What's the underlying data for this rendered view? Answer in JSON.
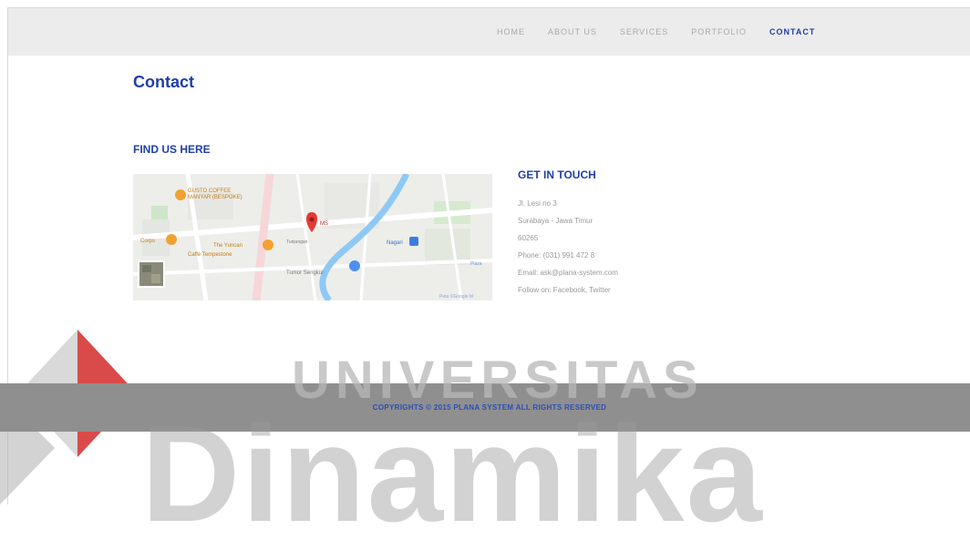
{
  "nav": {
    "items": [
      "HOME",
      "ABOUT US",
      "SERVICES",
      "PORTFOLIO",
      "CONTACT"
    ],
    "active": "CONTACT"
  },
  "page": {
    "title": "Contact"
  },
  "find": {
    "heading": "FIND US HERE",
    "map_labels": {
      "coffee": "GUSTO COFFEE",
      "coffee_sub": "MANYAR (BESPOKE)",
      "pin": "MS",
      "place1": "The Yuncan",
      "place2": "Caffe Tempestone",
      "place3": "Corps",
      "place4": "Tunjungan",
      "place5": "Tumor Sengkur",
      "place6": "Nagari",
      "place7": "Plaza",
      "credit": "Peta ©Google M"
    }
  },
  "touch": {
    "heading": "GET IN TOUCH",
    "lines": [
      "Jl. Lesi no 3",
      "Surabaya - Jawa Timur",
      "60265",
      "Phone: (031) 991 472 8",
      "Email: ask@plana-system.com",
      "Follow on: Facebook, Twitter"
    ]
  },
  "footer": {
    "text": "COPYRIGHTS © 2015 PLANA SYSTEM ALL RIGHTS RESERVED"
  },
  "watermark": {
    "word": "UNIVERSITAS",
    "brand": "Dinamika"
  },
  "colors": {
    "accent": "#1f3fa8",
    "nav_bg": "#ececec",
    "footer_band": "#8f8f8f",
    "logo_red": "#d22b2b",
    "pin_red": "#e53935"
  }
}
